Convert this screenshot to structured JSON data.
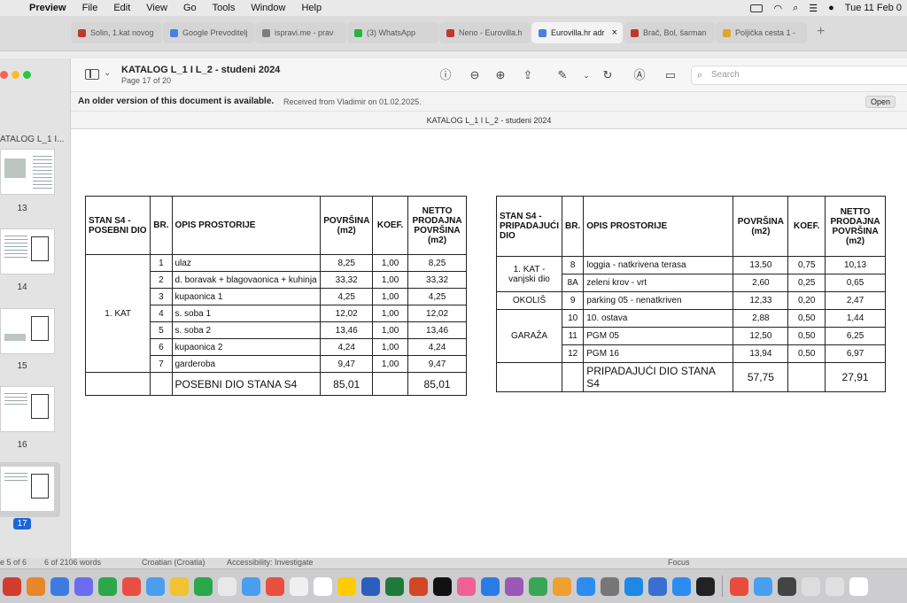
{
  "menubar": {
    "app": "Preview",
    "items": [
      "File",
      "Edit",
      "View",
      "Go",
      "Tools",
      "Window",
      "Help"
    ],
    "clock": "Tue 11 Feb 0"
  },
  "safari_tabs": [
    {
      "label": "Solin, 1.kat novog",
      "color": "#c0392b",
      "active": false
    },
    {
      "label": "Google Prevoditelj",
      "color": "#4a80e0",
      "active": false
    },
    {
      "label": "ispravi.me - prav",
      "color": "#7d7d7d",
      "active": false
    },
    {
      "label": "(3) WhatsApp",
      "color": "#2ab540",
      "active": false
    },
    {
      "label": "Neno - Eurovilla.h",
      "color": "#c0392b",
      "active": false
    },
    {
      "label": "Eurovilla.hr adr",
      "color": "#4a80e0",
      "active": true
    },
    {
      "label": "Brač, Bol, šarman",
      "color": "#c0392b",
      "active": false
    },
    {
      "label": "Poljička cesta 1 -",
      "color": "#e0a52b",
      "active": false
    }
  ],
  "toolbar": {
    "title": "KATALOG L_1 I L_2 - studeni 2024",
    "page_info": "Page 17 of 20",
    "search_placeholder": "Search"
  },
  "banner": {
    "message": "An older version of this document is available.",
    "received": "Received from Vladimir on 01.02.2025.",
    "open_label": "Open"
  },
  "doc_header": "KATALOG L_1 I L_2 - studeni 2024",
  "sidebar": {
    "doc_label": "ATALOG L_1 I...",
    "pages": [
      "13",
      "14",
      "15",
      "16",
      "17"
    ],
    "selected": "17"
  },
  "table_left": {
    "h_group": "STAN S4 - POSEBNI DIO",
    "h_br": "BR.",
    "h_opis": "OPIS PROSTORIJE",
    "h_povrsina": "POVRŠINA (m2)",
    "h_koef": "KOEF.",
    "h_netto": "NETTO PRODAJNA POVRŠINA (m2)",
    "group_label": "1. KAT",
    "rows": [
      {
        "br": "1",
        "opis": "ulaz",
        "pov": "8,25",
        "koef": "1,00",
        "netto": "8,25"
      },
      {
        "br": "2",
        "opis": "d. boravak + blagovaonica + kuhinja",
        "pov": "33,32",
        "koef": "1,00",
        "netto": "33,32"
      },
      {
        "br": "3",
        "opis": "kupaonica 1",
        "pov": "4,25",
        "koef": "1,00",
        "netto": "4,25"
      },
      {
        "br": "4",
        "opis": "s. soba 1",
        "pov": "12,02",
        "koef": "1,00",
        "netto": "12,02"
      },
      {
        "br": "5",
        "opis": "s. soba 2",
        "pov": "13,46",
        "koef": "1,00",
        "netto": "13,46"
      },
      {
        "br": "6",
        "opis": "kupaonica 2",
        "pov": "4,24",
        "koef": "1,00",
        "netto": "4,24"
      },
      {
        "br": "7",
        "opis": "garderoba",
        "pov": "9,47",
        "koef": "1,00",
        "netto": "9,47"
      }
    ],
    "total_label": "POSEBNI DIO STANA S4",
    "total_pov": "85,01",
    "total_netto": "85,01"
  },
  "table_right": {
    "h_group": "STAN S4 - PRIPADAJUĆI DIO",
    "h_br": "BR.",
    "h_opis": "OPIS PROSTORIJE",
    "h_povrsina": "POVRŠINA (m2)",
    "h_koef": "KOEF.",
    "h_netto": "NETTO PRODAJNA POVRŠINA (m2)",
    "group_1": "1. KAT - vanjski dio",
    "group_2": "OKOLIŠ",
    "group_3": "GARAŽA",
    "rows": [
      {
        "br": "8",
        "opis": "loggia - natkrivena terasa",
        "pov": "13,50",
        "koef": "0,75",
        "netto": "10,13"
      },
      {
        "br": "8A",
        "opis": "zeleni krov - vrt",
        "pov": "2,60",
        "koef": "0,25",
        "netto": "0,65"
      },
      {
        "br": "9",
        "opis": "parking 05 - nenatkriven",
        "pov": "12,33",
        "koef": "0,20",
        "netto": "2,47"
      },
      {
        "br": "10",
        "opis": "10. ostava",
        "pov": "2,88",
        "koef": "0,50",
        "netto": "1,44"
      },
      {
        "br": "11",
        "opis": "PGM 05",
        "pov": "12,50",
        "koef": "0,50",
        "netto": "6,25"
      },
      {
        "br": "12",
        "opis": "PGM 16",
        "pov": "13,94",
        "koef": "0,50",
        "netto": "6,97"
      }
    ],
    "total_label": "PRIPADAJUĆI DIO STANA S4",
    "total_pov": "57,75",
    "total_netto": "27,91"
  },
  "statusbar": {
    "pages": "e 5 of 6",
    "words": "6 of 2106 words",
    "language": "Croatian (Croatia)",
    "accessibility": "Accessibility: Investigate",
    "focus": "Focus"
  },
  "dock_colors": [
    "#d23c2e",
    "#e8862a",
    "#3d7be0",
    "#6c6cf0",
    "#2aa84a",
    "#e94f40",
    "#4a9ef0",
    "#f1c232",
    "#2aa84a",
    "#e8e8e8",
    "#4a9ef0",
    "#e94f40",
    "#f0f0f0",
    "#ffffff",
    "#ffcc00",
    "#2c5fbd",
    "#1f7a3a",
    "#d24726",
    "#111111",
    "#f06292",
    "#2a7be4",
    "#9b59b6",
    "#3aa655",
    "#f0a030",
    "#2d8cf0",
    "#777777",
    "#1e88e5",
    "#3a6fd0",
    "#2d8cf0",
    "#222222",
    "#e74c3c",
    "#4a9ef0",
    "#444444",
    "#dddddd",
    "#e0e0e0",
    "#ffffff"
  ]
}
